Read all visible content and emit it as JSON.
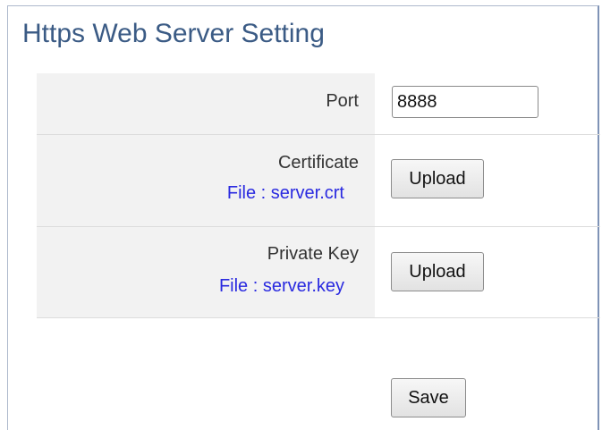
{
  "page": {
    "title": "Https Web Server Setting"
  },
  "port": {
    "label": "Port",
    "value": "8888"
  },
  "certificate": {
    "label": "Certificate",
    "file_text": "File : server.crt",
    "upload_label": "Upload"
  },
  "private_key": {
    "label": "Private Key",
    "file_text": "File : server.key",
    "upload_label": "Upload"
  },
  "actions": {
    "save_label": "Save"
  },
  "colors": {
    "title": "#3b5b85",
    "file_link": "#2a2ae0",
    "label_cell_bg": "#f2f2f2",
    "frame_border": "#7f93b6"
  }
}
